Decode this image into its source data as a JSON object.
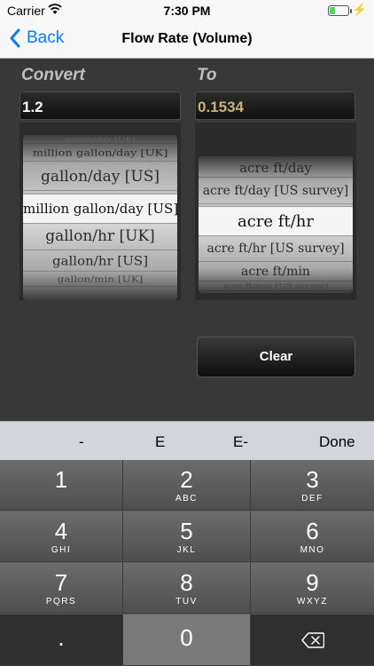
{
  "status": {
    "carrier": "Carrier",
    "time": "7:30 PM"
  },
  "nav": {
    "back_label": "Back",
    "title": "Flow Rate (Volume)"
  },
  "convert": {
    "label": "Convert",
    "value": "1.2",
    "picker_items": [
      "gallon/day [UK]",
      "million gallon/day [UK]",
      "gallon/day [US]",
      "million gallon/day [US]",
      "gallon/hr [UK]",
      "gallon/hr [US]",
      "gallon/min [UK]"
    ],
    "selected": "million gallon/day [US]"
  },
  "to": {
    "label": "To",
    "value": "0.1534",
    "picker_items": [
      "acre ft/day",
      "acre ft/day [US survey]",
      "acre ft/hr",
      "acre ft/hr [US survey]",
      "acre ft/min",
      "acre ft/min [US survey]"
    ],
    "selected": "acre ft/hr"
  },
  "clear_label": "Clear",
  "accessory": {
    "minus": "-",
    "e": "E",
    "e_minus": "E-",
    "done": "Done"
  },
  "keys": [
    {
      "digit": "1",
      "letters": ""
    },
    {
      "digit": "2",
      "letters": "ABC"
    },
    {
      "digit": "3",
      "letters": "DEF"
    },
    {
      "digit": "4",
      "letters": "GHI"
    },
    {
      "digit": "5",
      "letters": "JKL"
    },
    {
      "digit": "6",
      "letters": "MNO"
    },
    {
      "digit": "7",
      "letters": "PQRS"
    },
    {
      "digit": "8",
      "letters": "TUV"
    },
    {
      "digit": "9",
      "letters": "WXYZ"
    },
    {
      "digit": ".",
      "letters": ""
    },
    {
      "digit": "0",
      "letters": ""
    }
  ],
  "colors": {
    "accent": "#0a7aff",
    "converted_value": "#c9b27a"
  }
}
